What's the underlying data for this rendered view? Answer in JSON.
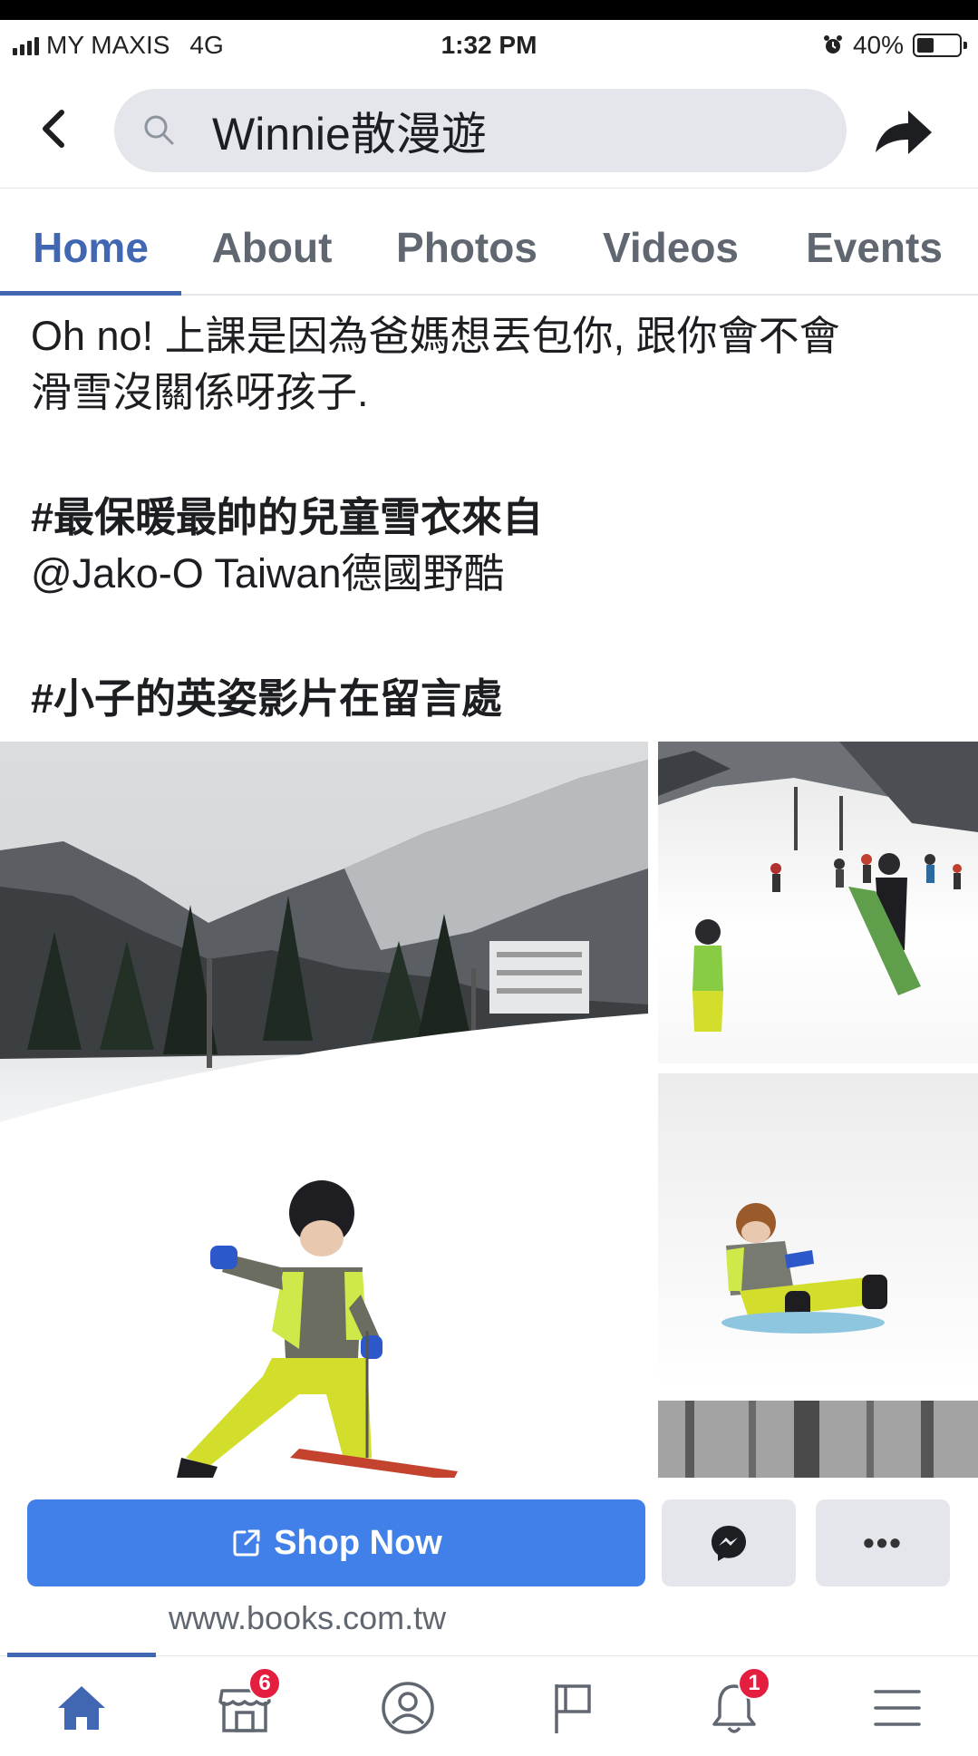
{
  "status_bar": {
    "carrier": "MY MAXIS",
    "network": "4G",
    "time": "1:32 PM",
    "battery": "40%",
    "battery_level": 0.4
  },
  "header": {
    "search_text": "Winnie散漫遊",
    "back_icon": "chevron-left-icon",
    "share_icon": "share-arrow-icon"
  },
  "tabs": [
    {
      "label": "Home",
      "active": true
    },
    {
      "label": "About",
      "active": false
    },
    {
      "label": "Photos",
      "active": false
    },
    {
      "label": "Videos",
      "active": false
    },
    {
      "label": "Events",
      "active": false
    }
  ],
  "post": {
    "line1": "Oh no! 上課是因為爸媽想丟包你, 跟你會不會\n滑雪沒關係呀孩子.",
    "hashtag1": "#最保暖最帥的兒童雪衣來自",
    "mention": "@Jako-O Taiwan德國野酷",
    "hashtag2": "#小子的英姿影片在留言處"
  },
  "photos": [
    {
      "name": "child-skiing-main"
    },
    {
      "name": "ski-slope-crowd"
    },
    {
      "name": "child-sledding"
    },
    {
      "name": "snowy-forest"
    }
  ],
  "actions": {
    "shop_label": "Shop Now",
    "more_label": "•••",
    "url": "www.books.com.tw"
  },
  "bottom_nav": {
    "marketplace_badge": "6",
    "notifications_badge": "1"
  },
  "colors": {
    "accent": "#4267b2",
    "button_blue": "#4080e8",
    "badge_red": "#e41e3f"
  }
}
